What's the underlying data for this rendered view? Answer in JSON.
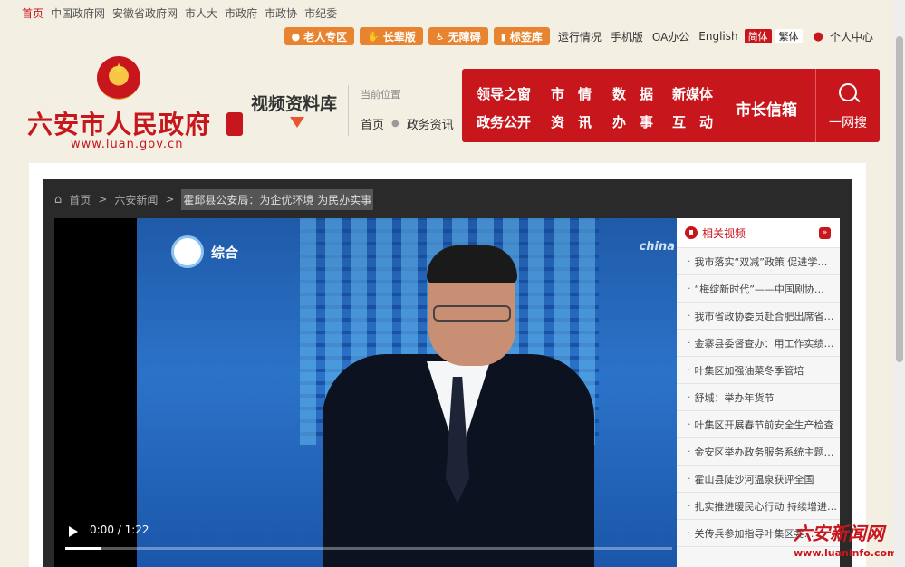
{
  "top_links": [
    "首页",
    "中国政府网",
    "安徽省政府网",
    "市人大",
    "市政府",
    "市政协",
    "市纪委"
  ],
  "tools": {
    "elder": "老人专区",
    "elder_icon": "user-icon",
    "senior": "长辈版",
    "senior_icon": "hand-icon",
    "accessible": "无障碍",
    "accessible_icon": "wheelchair-icon",
    "tags": "标签库",
    "tags_icon": "bookmark-icon",
    "links": [
      "运行情况",
      "手机版",
      "OA办公",
      "English"
    ],
    "lang_simplified": "简体",
    "lang_traditional": "繁体",
    "personal": "个人中心"
  },
  "header": {
    "site_name": "六安市人民政府",
    "site_url": "www.luan.gov.cn",
    "section_title": "视频资料库",
    "location_label": "当前位置",
    "location_path": [
      "首页",
      "政务资讯"
    ]
  },
  "nav": {
    "items": [
      "领导之窗",
      "市　情",
      "数　据",
      "新媒体",
      "政务公开",
      "资　讯",
      "办　事",
      "互　动"
    ],
    "mayor_mailbox": "市长信箱",
    "search": "一网搜"
  },
  "breadcrumb": [
    "首页",
    "六安新闻",
    "霍邱县公安局：为企优环境 为民办实事"
  ],
  "video": {
    "channel_label": "综合",
    "corner_text": "china",
    "time": "0:00 / 1:22",
    "progress": 0.06
  },
  "related": {
    "title": "相关视频",
    "items": [
      "我市落实“双减”政策 促进学…",
      "“梅绽新时代”——中国剧协…",
      "我市省政协委员赴合肥出席省…",
      "金寨县委督查办：用工作实绩…",
      "叶集区加强油菜冬季管培",
      "舒城：举办年货节",
      "叶集区开展春节前安全生产检查",
      "金安区举办政务服务系统主题…",
      "霍山县陡沙河温泉获评全国",
      "扎实推进暖民心行动 持续增进…",
      "关传兵参加指导叶集区委…"
    ]
  },
  "watermark": {
    "logo_text": "六安新闻网",
    "url": "www.luaninfo.com"
  },
  "colors": {
    "brand_red": "#c8161d",
    "orange": "#e8842f",
    "background": "#f3efe3"
  }
}
